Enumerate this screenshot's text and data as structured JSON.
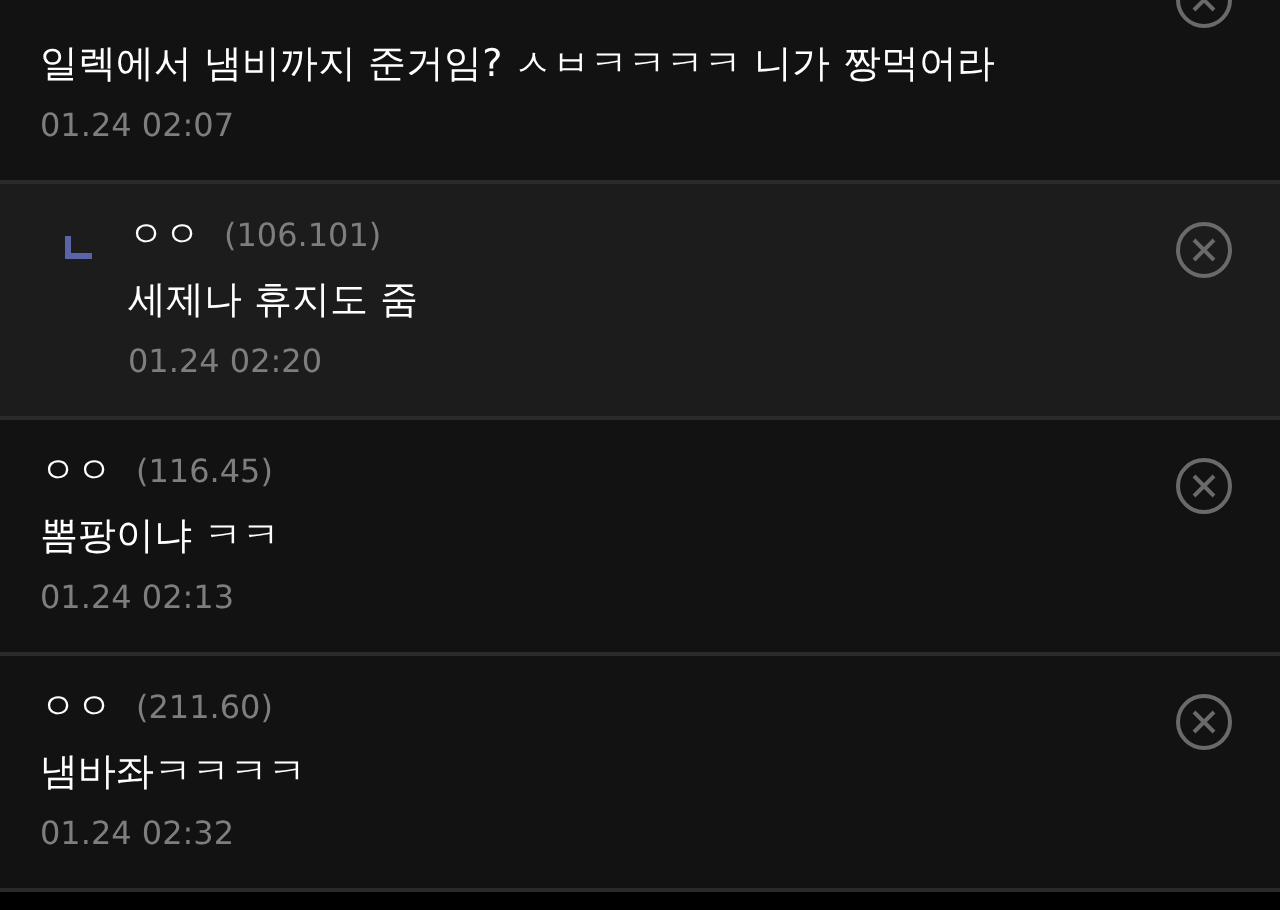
{
  "comments": [
    {
      "kind": "comment",
      "text": "일렉에서 냄비까지 준거임? ㅅㅂㅋㅋㅋㅋ 니가 짱먹어라",
      "time": "01.24 02:07"
    },
    {
      "kind": "reply",
      "author": "ㅇㅇ",
      "ip": "(106.101)",
      "text": "세제나 휴지도 줌",
      "time": "01.24 02:20"
    },
    {
      "kind": "comment",
      "author": "ㅇㅇ",
      "ip": "(116.45)",
      "text": "뽐팡이냐 ㅋㅋ",
      "time": "01.24 02:13"
    },
    {
      "kind": "comment",
      "author": "ㅇㅇ",
      "ip": "(211.60)",
      "text": "냄바좌ㅋㅋㅋㅋ",
      "time": "01.24 02:32"
    }
  ]
}
